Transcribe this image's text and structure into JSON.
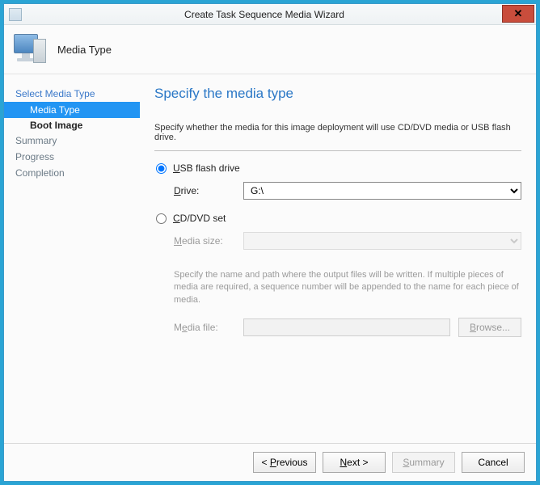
{
  "window": {
    "title": "Create Task Sequence Media Wizard"
  },
  "header": {
    "title": "Media Type"
  },
  "sidebar": {
    "items": [
      {
        "label": "Select Media Type",
        "type": "top"
      },
      {
        "label": "Media Type",
        "type": "sub-selected"
      },
      {
        "label": "Boot Image",
        "type": "sub-bold"
      },
      {
        "label": "Summary",
        "type": "top-muted"
      },
      {
        "label": "Progress",
        "type": "top-muted"
      },
      {
        "label": "Completion",
        "type": "top-muted"
      }
    ]
  },
  "content": {
    "page_title": "Specify the media type",
    "instruction": "Specify whether the media for this image deployment will use CD/DVD media or USB flash drive.",
    "option_usb": {
      "prefix": "U",
      "rest": "SB flash drive",
      "checked": true
    },
    "drive_label": {
      "prefix": "D",
      "rest": "rive:"
    },
    "drive_value": "G:\\",
    "option_cd": {
      "prefix": "C",
      "rest": "D/DVD set",
      "checked": false
    },
    "media_size_label": {
      "prefix": "M",
      "rest": "edia size:"
    },
    "media_size_value": "",
    "help_text": "Specify the name and path where the output files will be written.  If multiple pieces of media are required, a sequence number will be appended to the name for each piece of media.",
    "media_file_label": {
      "rest_before": "M",
      "ul": "e",
      "rest_after": "dia file:"
    },
    "media_file_value": "",
    "browse_label": {
      "prefix": "B",
      "rest": "rowse..."
    }
  },
  "footer": {
    "previous": {
      "prefix": "< ",
      "ul": "P",
      "rest": "revious"
    },
    "next": {
      "ul": "N",
      "rest": "ext >"
    },
    "summary": {
      "ul": "S",
      "rest": "ummary"
    },
    "cancel": "Cancel"
  }
}
